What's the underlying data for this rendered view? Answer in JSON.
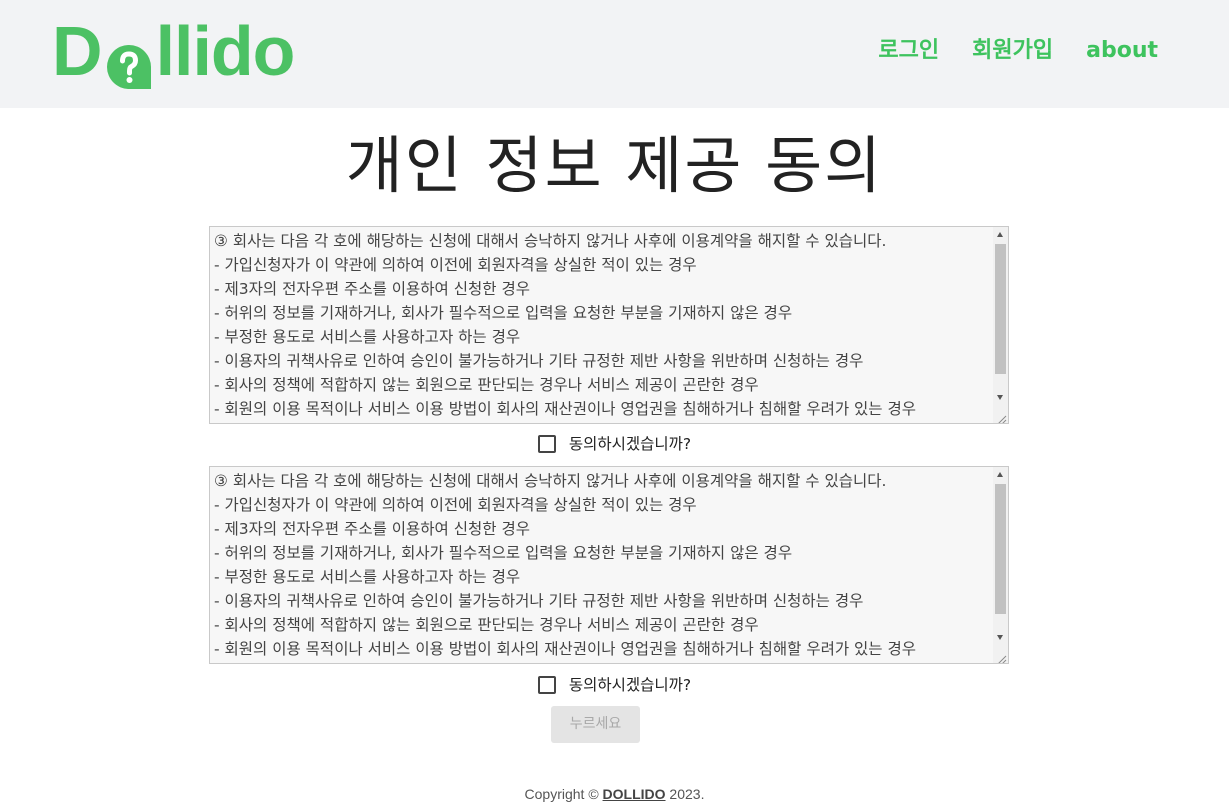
{
  "header": {
    "logo_prefix": "D",
    "logo_suffix": "llido",
    "nav": {
      "login": "로그인",
      "signup": "회원가입",
      "about": "about"
    }
  },
  "page": {
    "title": "개인 정보 제공 동의"
  },
  "terms": [
    {
      "lines": [
        "③ 회사는 다음 각 호에 해당하는 신청에 대해서 승낙하지 않거나 사후에 이용계약을 해지할 수 있습니다.",
        "- 가입신청자가 이 약관에 의하여 이전에 회원자격을 상실한 적이 있는 경우",
        "- 제3자의 전자우편 주소를 이용하여 신청한 경우",
        "- 허위의 정보를 기재하거나, 회사가 필수적으로 입력을 요청한 부분을 기재하지 않은 경우",
        "- 부정한 용도로 서비스를 사용하고자 하는 경우",
        "- 이용자의 귀책사유로 인하여 승인이 불가능하거나 기타 규정한 제반 사항을 위반하며 신청하는 경우",
        "- 회사의 정책에 적합하지 않는 회원으로 판단되는 경우나 서비스 제공이 곤란한 경우",
        "- 회원의 이용 목적이나 서비스 이용 방법이 회사의 재산권이나 영업권을 침해하거나 침해할 우려가 있는 경우"
      ],
      "agree_label": "동의하시겠습니까?"
    },
    {
      "lines": [
        "③ 회사는 다음 각 호에 해당하는 신청에 대해서 승낙하지 않거나 사후에 이용계약을 해지할 수 있습니다.",
        "- 가입신청자가 이 약관에 의하여 이전에 회원자격을 상실한 적이 있는 경우",
        "- 제3자의 전자우편 주소를 이용하여 신청한 경우",
        "- 허위의 정보를 기재하거나, 회사가 필수적으로 입력을 요청한 부분을 기재하지 않은 경우",
        "- 부정한 용도로 서비스를 사용하고자 하는 경우",
        "- 이용자의 귀책사유로 인하여 승인이 불가능하거나 기타 규정한 제반 사항을 위반하며 신청하는 경우",
        "- 회사의 정책에 적합하지 않는 회원으로 판단되는 경우나 서비스 제공이 곤란한 경우",
        "- 회원의 이용 목적이나 서비스 이용 방법이 회사의 재산권이나 영업권을 침해하거나 침해할 우려가 있는 경우"
      ],
      "agree_label": "동의하시겠습니까?"
    }
  ],
  "submit_label": "누르세요",
  "footer": {
    "prefix": "Copyright ©",
    "brand": "DOLLIDO",
    "year": "2023."
  },
  "colors": {
    "brand_green": "#4cc164",
    "nav_green": "#3ec35e",
    "header_bg": "#f2f3f5"
  }
}
